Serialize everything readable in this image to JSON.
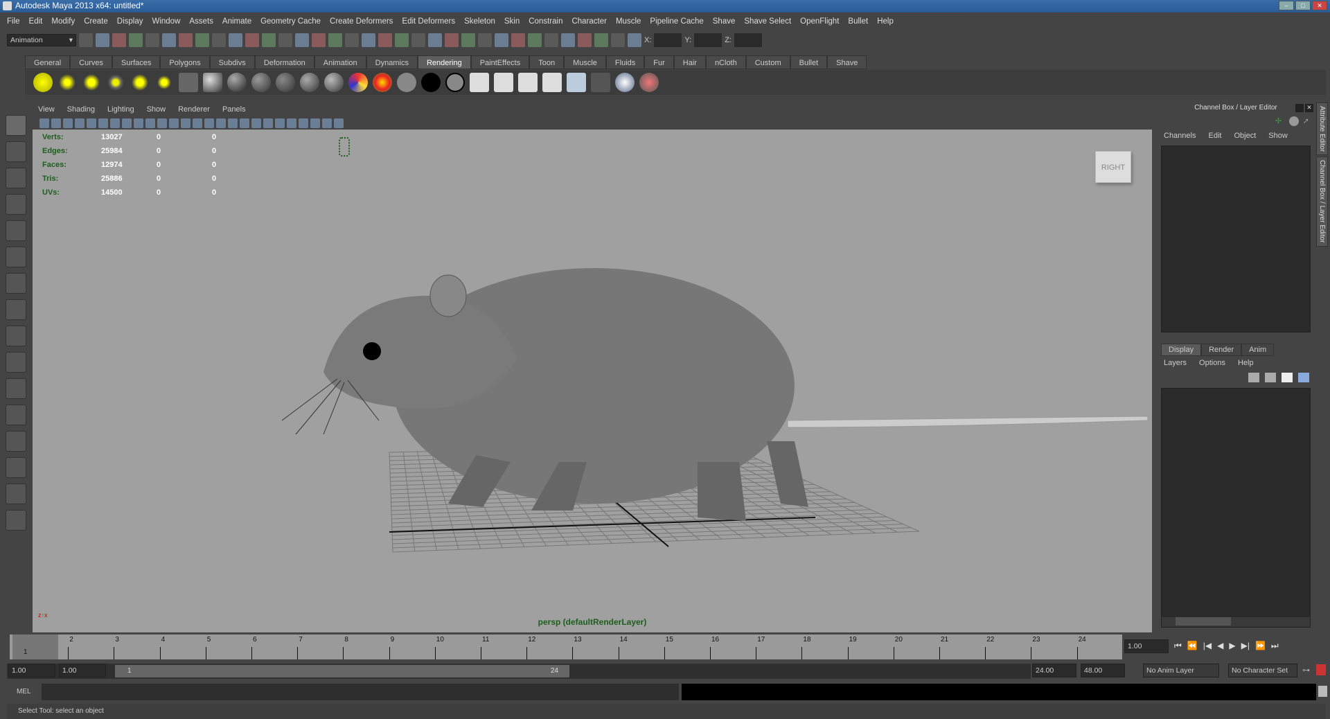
{
  "title": "Autodesk Maya 2013 x64: untitled*",
  "menu": [
    "File",
    "Edit",
    "Modify",
    "Create",
    "Display",
    "Window",
    "Assets",
    "Animate",
    "Geometry Cache",
    "Create Deformers",
    "Edit Deformers",
    "Skeleton",
    "Skin",
    "Constrain",
    "Character",
    "Muscle",
    "Pipeline Cache",
    "Shave",
    "Shave Select",
    "OpenFlight",
    "Bullet",
    "Help"
  ],
  "toolbar": {
    "mode": "Animation",
    "x_label": "X:",
    "y_label": "Y:",
    "z_label": "Z:"
  },
  "shelf_tabs": [
    "General",
    "Curves",
    "Surfaces",
    "Polygons",
    "Subdivs",
    "Deformation",
    "Animation",
    "Dynamics",
    "Rendering",
    "PaintEffects",
    "Toon",
    "Muscle",
    "Fluids",
    "Fur",
    "Hair",
    "nCloth",
    "Custom",
    "Bullet",
    "Shave"
  ],
  "active_shelf": "Rendering",
  "panel_menu": [
    "View",
    "Shading",
    "Lighting",
    "Show",
    "Renderer",
    "Panels"
  ],
  "hud": [
    {
      "label": "Verts:",
      "v1": "13027",
      "v2": "0",
      "v3": "0"
    },
    {
      "label": "Edges:",
      "v1": "25984",
      "v2": "0",
      "v3": "0"
    },
    {
      "label": "Faces:",
      "v1": "12974",
      "v2": "0",
      "v3": "0"
    },
    {
      "label": "Tris:",
      "v1": "25886",
      "v2": "0",
      "v3": "0"
    },
    {
      "label": "UVs:",
      "v1": "14500",
      "v2": "0",
      "v3": "0"
    }
  ],
  "viewcube": "RIGHT",
  "camera_label": "persp (defaultRenderLayer)",
  "channel_box": {
    "title": "Channel Box / Layer Editor",
    "menu": [
      "Channels",
      "Edit",
      "Object",
      "Show"
    ]
  },
  "layer_editor": {
    "tabs": [
      "Display",
      "Render",
      "Anim"
    ],
    "menu": [
      "Layers",
      "Options",
      "Help"
    ]
  },
  "side_tabs": [
    "Attribute Editor",
    "Channel Box / Layer Editor"
  ],
  "timeline": {
    "ticks": [
      "1",
      "2",
      "3",
      "4",
      "5",
      "6",
      "7",
      "8",
      "9",
      "10",
      "11",
      "12",
      "13",
      "14",
      "15",
      "16",
      "17",
      "18",
      "19",
      "20",
      "21",
      "22",
      "23",
      "24"
    ],
    "current_frame": "1",
    "current_field": "1.00"
  },
  "range": {
    "start": "1.00",
    "inner_start": "1.00",
    "slider_start": "1",
    "slider_end": "24",
    "end": "24.00",
    "outer_end": "48.00",
    "anim_layer": "No Anim Layer",
    "char_set": "No Character Set"
  },
  "mel_label": "MEL",
  "help_line": "Select Tool: select an object"
}
